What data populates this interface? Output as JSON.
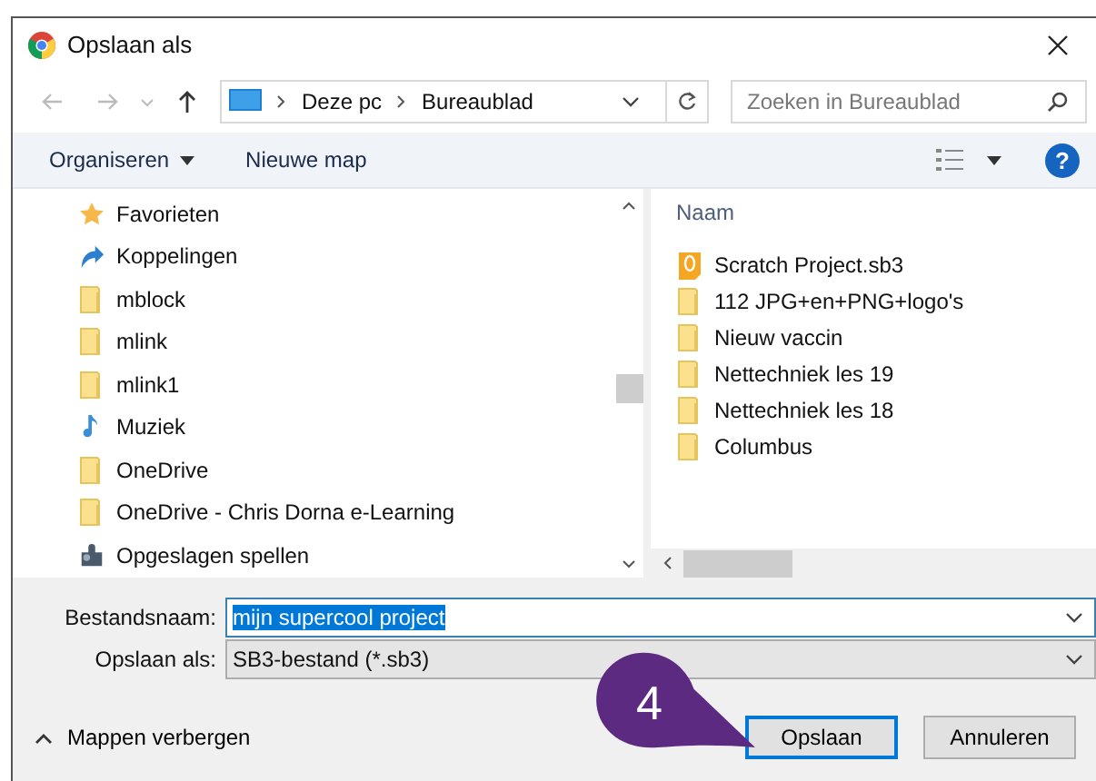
{
  "window": {
    "title": "Opslaan als"
  },
  "address": {
    "crumbs": [
      "Deze pc",
      "Bureaublad"
    ]
  },
  "search": {
    "placeholder": "Zoeken in Bureaublad"
  },
  "toolbar": {
    "organize": "Organiseren",
    "new_folder": "Nieuwe map",
    "help": "?"
  },
  "nav_items": [
    {
      "label": "Favorieten",
      "kind": "star"
    },
    {
      "label": "Koppelingen",
      "kind": "link"
    },
    {
      "label": "mblock",
      "kind": "folder"
    },
    {
      "label": "mlink",
      "kind": "folder"
    },
    {
      "label": "mlink1",
      "kind": "folder"
    },
    {
      "label": "Muziek",
      "kind": "music"
    },
    {
      "label": "OneDrive",
      "kind": "folder"
    },
    {
      "label": "OneDrive - Chris Dorna e-Learning",
      "kind": "folder"
    },
    {
      "label": "Opgeslagen spellen",
      "kind": "games"
    }
  ],
  "file_list": {
    "column": "Naam",
    "files": [
      {
        "name": "Scratch Project.sb3",
        "kind": "scratch"
      },
      {
        "name": "112 JPG+en+PNG+logo's",
        "kind": "folder"
      },
      {
        "name": "Nieuw vaccin",
        "kind": "folder"
      },
      {
        "name": "Nettechniek les 19",
        "kind": "folder"
      },
      {
        "name": "Nettechniek les 18",
        "kind": "folder"
      },
      {
        "name": "Columbus",
        "kind": "folder"
      }
    ]
  },
  "filename": {
    "label": "Bestandsnaam:",
    "value": "mijn supercool project",
    "selected": true
  },
  "filetype": {
    "label": "Opslaan als:",
    "value": "SB3-bestand (*.sb3)"
  },
  "hide_folders": "Mappen verbergen",
  "buttons": [
    {
      "label": "Opslaan",
      "kind": "primary"
    },
    {
      "label": "Annuleren",
      "kind": "normal"
    }
  ],
  "callout": {
    "text": "4"
  }
}
